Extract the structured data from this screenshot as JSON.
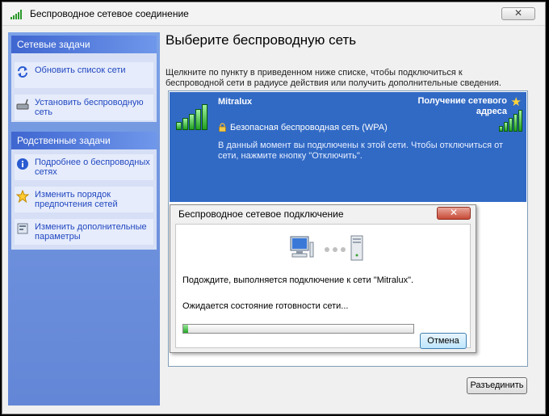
{
  "window": {
    "title": "Беспроводное сетевое соединение",
    "close_glyph": "✕"
  },
  "sidebar": {
    "network_tasks": {
      "header": "Сетевые задачи",
      "items": [
        {
          "label": "Обновить список сети",
          "icon": "refresh-icon"
        },
        {
          "label": "Установить беспроводную сеть",
          "icon": "router-icon"
        }
      ]
    },
    "related_tasks": {
      "header": "Родственные задачи",
      "items": [
        {
          "label": "Подробнее о беспроводных сетях",
          "icon": "info-icon"
        },
        {
          "label": "Изменить порядок предпочтения сетей",
          "icon": "star-icon"
        },
        {
          "label": "Изменить дополнительные параметры",
          "icon": "settings-icon"
        }
      ]
    }
  },
  "main": {
    "heading": "Выберите беспроводную сеть",
    "description": "Щелкните по пункту в приведенном ниже списке, чтобы подключиться к беспроводной сети в радиусе действия или получить дополнительные сведения."
  },
  "network": {
    "name": "Mitralux",
    "status": "Получение сетевого адреса",
    "security": "Безопасная беспроводная сеть (WPA)",
    "info": "В данный момент вы подключены к этой сети. Чтобы отключиться от сети, нажмите кнопку \"Отключить\".",
    "selected_color": "#316ac5"
  },
  "dialog": {
    "title": "Беспроводное сетевое подключение",
    "close_glyph": "✕",
    "message": "Подождите, выполняется подключение к сети \"Mitralux\".",
    "waiting": "Ожидается состояние готовности сети...",
    "progress_fraction": 0.02,
    "cancel_label": "Отмена"
  },
  "disconnect_label": "Разъединить"
}
